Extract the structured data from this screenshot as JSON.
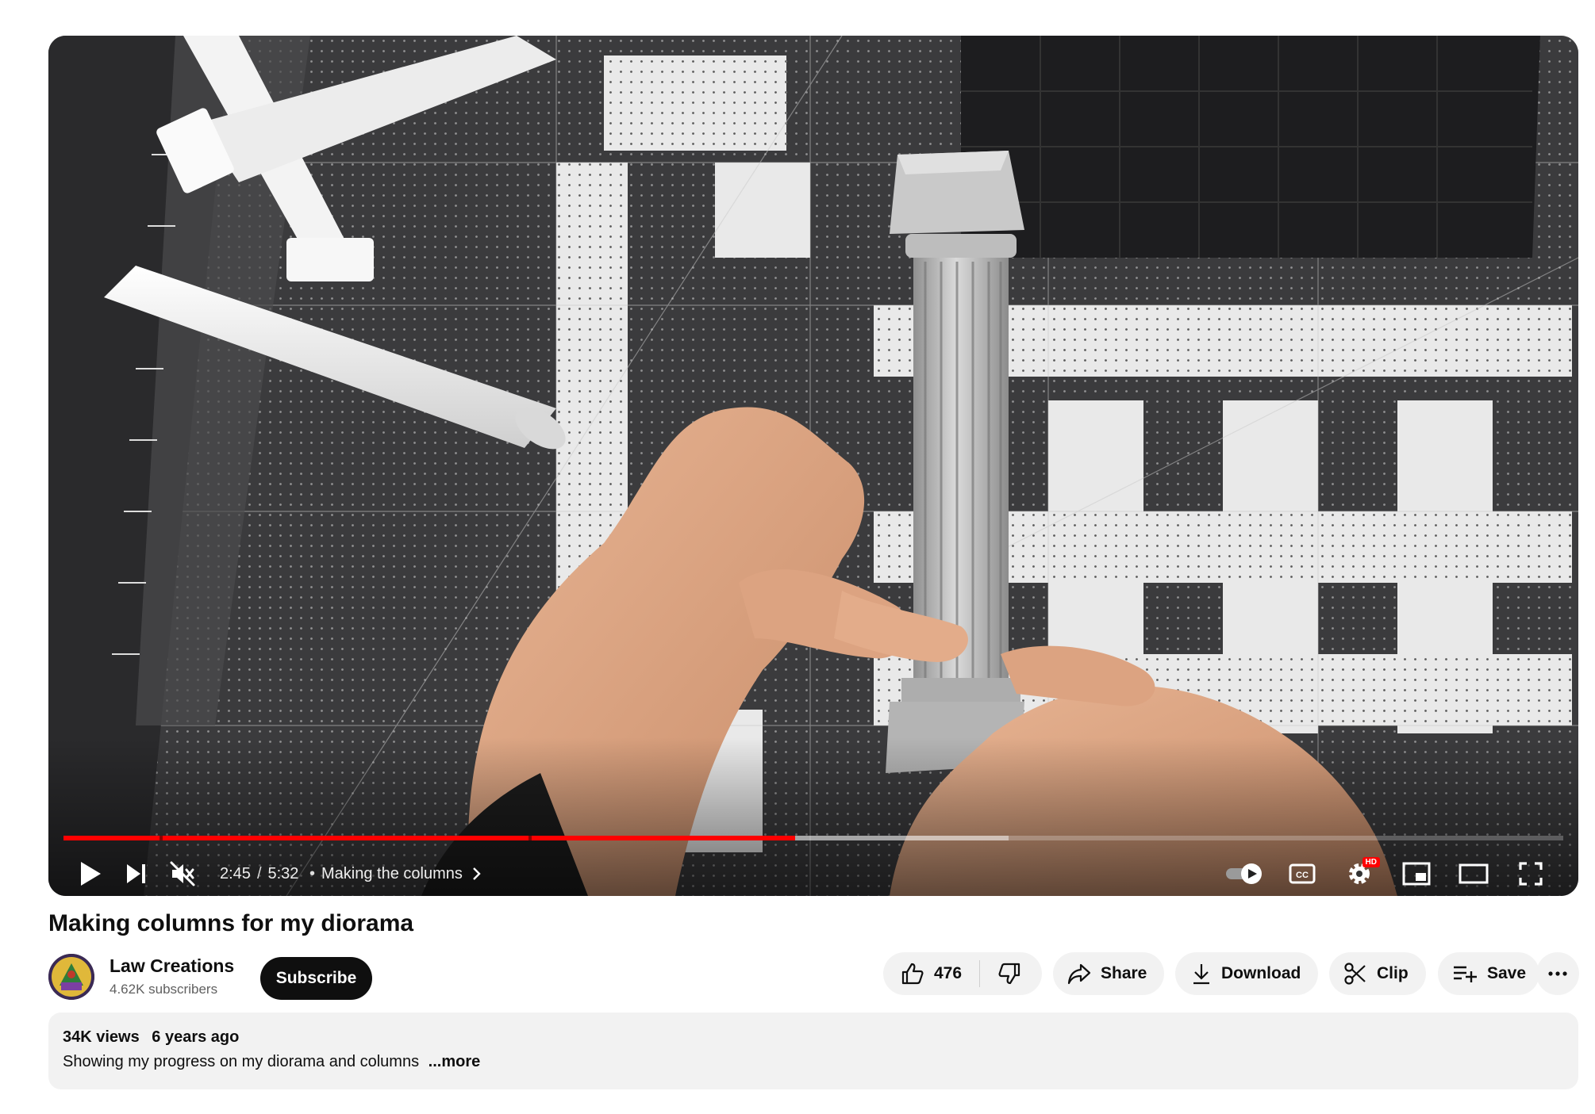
{
  "video": {
    "title": "Making columns for my diorama",
    "current_time": "2:45",
    "duration": "5:32",
    "time_separator": "/",
    "chapter_separator": "•",
    "chapter_title": "Making the columns",
    "progress_fraction": 0.488,
    "buffered_fraction": 0.63,
    "chapter_marks_fraction": [
      0.064,
      0.31
    ],
    "muted": true,
    "autoplay_on": true,
    "quality_badge": "HD",
    "accent_color": "#ff0000"
  },
  "channel": {
    "name": "Law Creations",
    "subscribers": "4.62K subscribers",
    "subscribe_label": "Subscribe"
  },
  "actions": {
    "like_count": "476",
    "share_label": "Share",
    "download_label": "Download",
    "clip_label": "Clip",
    "save_label": "Save"
  },
  "description": {
    "views": "34K views",
    "age": "6 years ago",
    "text": "Showing my progress on my diorama and columns",
    "more_label": "...more"
  },
  "icons": {
    "play": "play-icon",
    "next": "next-icon",
    "mute": "volume-muted-icon",
    "chapter": "chevron-right-icon",
    "autoplay": "autoplay-toggle-icon",
    "captions": "closed-captions-icon",
    "settings": "gear-icon",
    "miniplayer": "miniplayer-icon",
    "theater": "theater-mode-icon",
    "fullscreen": "fullscreen-icon",
    "like": "thumbs-up-icon",
    "dislike": "thumbs-down-icon",
    "share": "share-arrow-icon",
    "download": "download-icon",
    "clip": "scissors-icon",
    "save": "add-to-playlist-icon",
    "more": "more-horizontal-icon"
  }
}
